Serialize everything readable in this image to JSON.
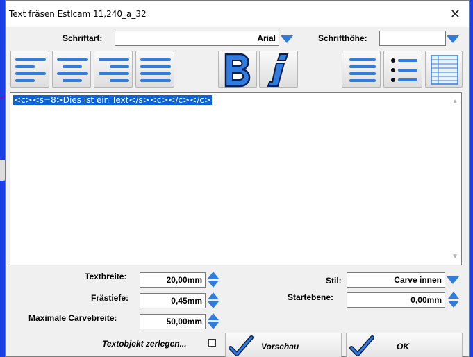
{
  "window": {
    "title": "Text fräsen Estlcam 11,240_a_32",
    "close_glyph": "✕"
  },
  "font": {
    "label": "Schriftart:",
    "value": "Arial",
    "dropdown_icon": "chevron-down-icon"
  },
  "font_height": {
    "label": "Schrifthöhe:",
    "value": "",
    "dropdown_icon": "chevron-down-icon"
  },
  "toolbar": {
    "align_left": "align-left-icon",
    "align_center": "align-center-icon",
    "align_right": "align-right-icon",
    "justify": "align-justify-icon",
    "bold": "bold-icon",
    "italic": "italic-icon",
    "paragraph": "paragraph-lines-icon",
    "list": "bullet-list-icon",
    "table": "table-icon"
  },
  "editor": {
    "text": "<c><s=8>Dies ist ein Text</s><c></c></c>"
  },
  "params": {
    "text_width": {
      "label": "Textbreite:",
      "value": "20,00mm"
    },
    "mill_depth": {
      "label": "Frästiefe:",
      "value": "0,45mm"
    },
    "max_carve_width": {
      "label": "Maximale Carvebreite:",
      "value": "50,00mm"
    },
    "style": {
      "label": "Stil:",
      "value": "Carve innen"
    },
    "start_level": {
      "label": "Startebene:",
      "value": "0,00mm"
    }
  },
  "split_object": {
    "label": "Textobjekt zerlegen...",
    "checked": false
  },
  "buttons": {
    "preview": "Vorschau",
    "ok": "OK"
  },
  "colors": {
    "accent": "#2f7de1",
    "selection": "#0a64d8"
  }
}
